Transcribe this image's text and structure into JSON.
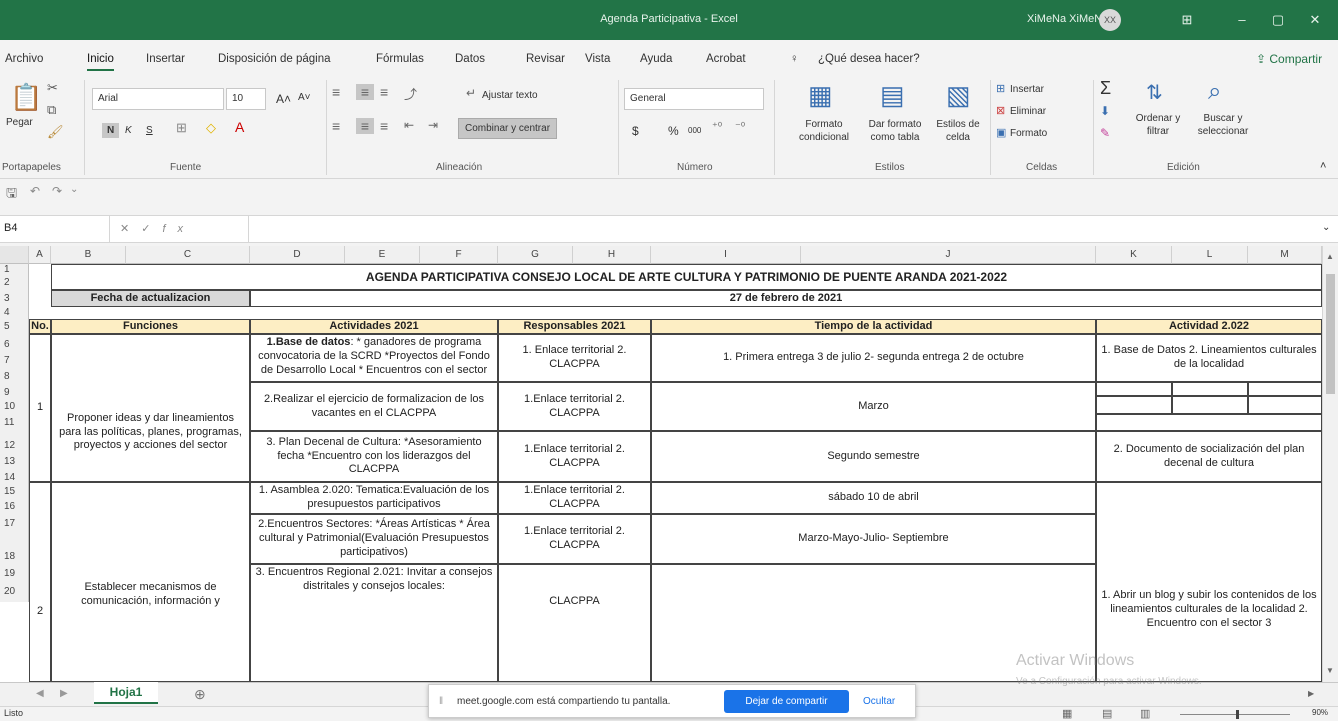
{
  "window": {
    "title": "Agenda Participativa  -  Excel",
    "user": "XiMeNa XiMeNa",
    "avatar": "XX",
    "min": "–",
    "max": "▢",
    "close": "✕",
    "display_icon": "⊞"
  },
  "tabs": [
    "Archivo",
    "Inicio",
    "Insertar",
    "Disposición de página",
    "Fórmulas",
    "Datos",
    "Revisar",
    "Vista",
    "Ayuda",
    "Acrobat"
  ],
  "tell_me": "¿Qué desea hacer?",
  "share": "Compartir",
  "ribbon": {
    "clipboard": {
      "paste": "Pegar",
      "group": "Portapapeles"
    },
    "font": {
      "name": "Arial",
      "size": "10",
      "grow": "A˄",
      "shrink": "A˅",
      "bold": "N",
      "italic": "K",
      "underline": "S",
      "group": "Fuente"
    },
    "alignment": {
      "wrap": "Ajustar texto",
      "merge": "Combinar y centrar",
      "group": "Alineación"
    },
    "number": {
      "format": "General",
      "currency": "$",
      "percent": "%",
      "thousands": "000",
      "group": "Número"
    },
    "styles": {
      "conditional": "Formato condicional",
      "as_table": "Dar formato como tabla",
      "cell_styles": "Estilos de celda",
      "group": "Estilos"
    },
    "cells": {
      "insert": "Insertar",
      "delete": "Eliminar",
      "format": "Formato",
      "group": "Celdas"
    },
    "editing": {
      "sort": "Ordenar y filtrar",
      "find": "Buscar y seleccionar",
      "group": "Edición"
    }
  },
  "name_box": "B4",
  "fx": "fx",
  "columns": [
    "A",
    "B",
    "C",
    "D",
    "E",
    "F",
    "G",
    "H",
    "I",
    "J",
    "K",
    "L",
    "M"
  ],
  "rows": [
    "1",
    "2",
    "3",
    "4",
    "5",
    "6",
    "7",
    "8",
    "9",
    "10",
    "11",
    "12",
    "13",
    "14",
    "15",
    "16",
    "17",
    "18",
    "19",
    "20"
  ],
  "sheet": {
    "title": "AGENDA PARTICIPATIVA CONSEJO LOCAL DE ARTE CULTURA Y PATRIMONIO DE PUENTE ARANDA 2021-2022",
    "date_label": "Fecha de actualizacion",
    "date_value": "27 de febrero de 2021",
    "headers": {
      "no": "No.",
      "funciones": "Funciones",
      "actividades": "Actividades 2021",
      "responsables": "Responsables 2021",
      "tiempo": "Tiempo  de la actividad",
      "actividad2022": "Actividad 2.022"
    },
    "group1": {
      "no": "1",
      "funcion": "Proponer ideas y dar lineamientos para las políticas, planes, programas, proyectos y acciones del sector",
      "act1_bold": "1.Base de datos",
      "act1_rest": ": * ganadores de programa convocatoria de la SCRD *Proyectos del Fondo de Desarrollo Local * Encuentros con el sector",
      "resp1": "1. Enlace territorial 2. CLACPPA",
      "time1": "1. Primera entrega 3 de julio 2- segunda entrega 2 de octubre",
      "k1": "1. Base de Datos 2. Lineamientos culturales de la localidad",
      "act2": "2.Realizar el ejercicio de formalizacion de los vacantes en el CLACPPA",
      "resp2": "1.Enlace territorial 2. CLACPPA",
      "time2": "Marzo",
      "act3": "3. Plan Decenal de Cultura: *Asesoramiento fecha *Encuentro con los liderazgos del CLACPPA",
      "resp3": "1.Enlace territorial 2. CLACPPA",
      "time3": "Segundo semestre",
      "k3": "2. Documento de socialización del plan decenal de cultura"
    },
    "group2": {
      "no": "2",
      "funcion": "Establecer mecanismos de comunicación, información y",
      "act1": "1. Asamblea 2.020: Tematica:Evaluación de los presupuestos participativos",
      "resp1": "1.Enlace territorial 2. CLACPPA",
      "time1": "sábado 10 de abril",
      "act2": "2.Encuentros Sectores: *Áreas Artísticas * Área cultural y Patrimonial(Evaluación Presupuestos participativos)",
      "resp2": "1.Enlace territorial 2. CLACPPA",
      "time2": "Marzo-Mayo-Julio- Septiembre",
      "act3": "3. Encuentros Regional  2.021: Invitar a consejos distritales y consejos locales:",
      "resp3": "CLACPPA",
      "time3": "",
      "k": "1. Abrir un blog y subir los contenidos de los lineamientos culturales de la localidad  2. Encuentro con el sector 3"
    }
  },
  "sheet_tab": "Hoja1",
  "add_sheet": "⊕",
  "status": "Listo",
  "zoom": "90%",
  "screen_share": {
    "message": "meet.google.com está compartiendo tu pantalla.",
    "stop": "Dejar de compartir",
    "hide": "Ocultar"
  },
  "watermark": {
    "line1": "Activar Windows",
    "line2": "Ve a Configuración para activar Windows."
  }
}
